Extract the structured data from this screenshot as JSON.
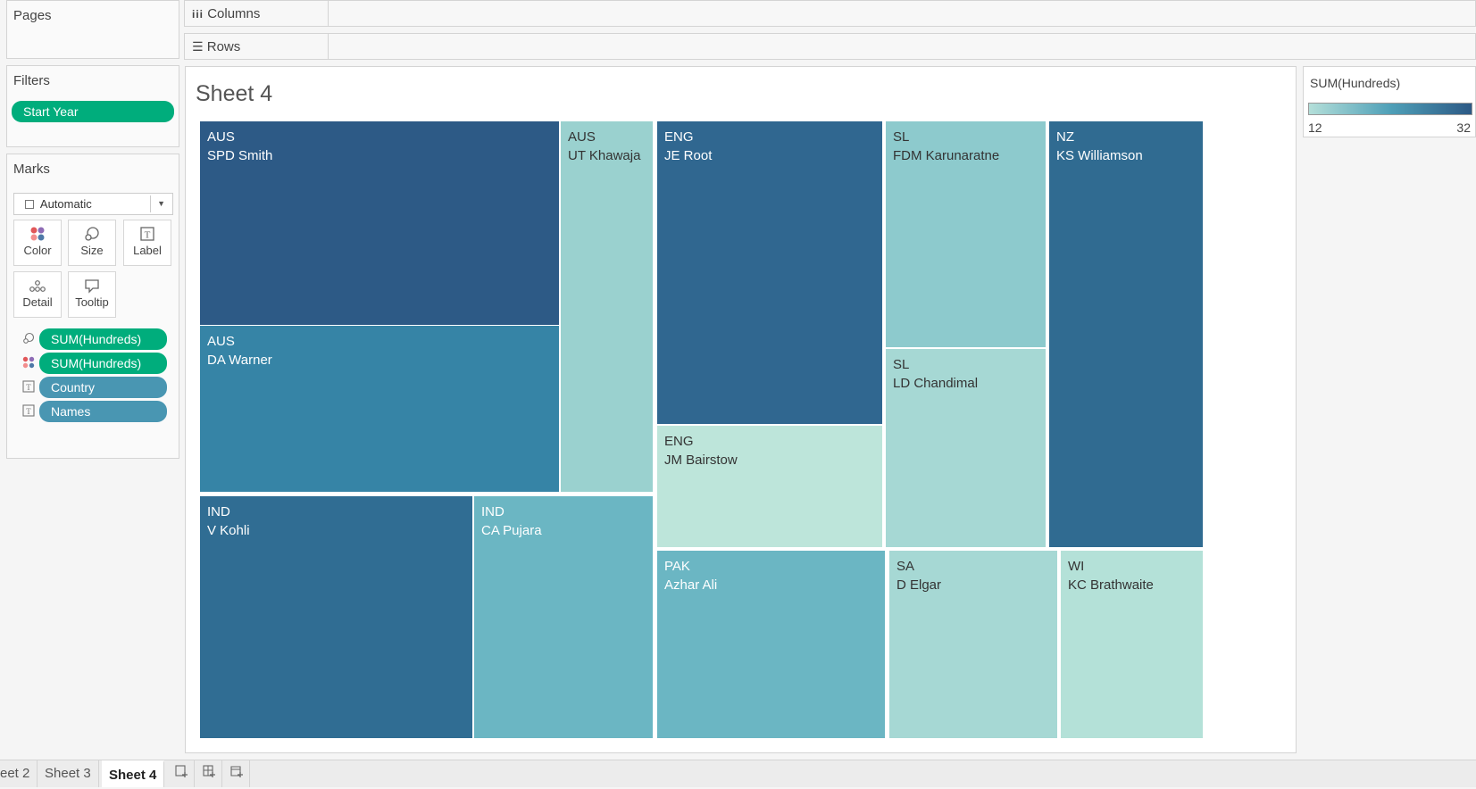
{
  "pages": {
    "title": "Pages"
  },
  "filters": {
    "title": "Filters",
    "pills": [
      "Start Year"
    ]
  },
  "marks": {
    "title": "Marks",
    "mark_type": "Automatic",
    "buttons": {
      "color": "Color",
      "size": "Size",
      "label": "Label",
      "detail": "Detail",
      "tooltip": "Tooltip"
    },
    "fields": [
      {
        "icon": "size-icon",
        "label": "SUM(Hundreds)",
        "kind": "measure"
      },
      {
        "icon": "color-icon",
        "label": "SUM(Hundreds)",
        "kind": "measure"
      },
      {
        "icon": "label-icon",
        "label": "Country",
        "kind": "dimension"
      },
      {
        "icon": "label-icon",
        "label": "Names",
        "kind": "dimension"
      }
    ]
  },
  "shelves": {
    "columns": "Columns",
    "rows": "Rows"
  },
  "sheet": {
    "title": "Sheet 4"
  },
  "legend": {
    "title": "SUM(Hundreds)",
    "min": "12",
    "max": "32",
    "color_min": "#b4dfd9",
    "color_max": "#2c5985"
  },
  "chart_data": {
    "type": "treemap",
    "tiles": [
      {
        "country": "AUS",
        "name": "SPD Smith",
        "color": "#2d5a86"
      },
      {
        "country": "AUS",
        "name": "DA Warner",
        "color": "#3684a6"
      },
      {
        "country": "AUS",
        "name": "UT Khawaja",
        "color": "#9ad1cf"
      },
      {
        "country": "IND",
        "name": "V Kohli",
        "color": "#306d93"
      },
      {
        "country": "IND",
        "name": "CA Pujara",
        "color": "#6bb6c3"
      },
      {
        "country": "ENG",
        "name": "JE Root",
        "color": "#306790"
      },
      {
        "country": "ENG",
        "name": "JM Bairstow",
        "color": "#bde5da"
      },
      {
        "country": "PAK",
        "name": "Azhar Ali",
        "color": "#6bb6c3"
      },
      {
        "country": "SL",
        "name": "FDM Karunaratne",
        "color": "#8dcacd"
      },
      {
        "country": "SL",
        "name": "LD Chandimal",
        "color": "#a6d8d4"
      },
      {
        "country": "SA",
        "name": "D Elgar",
        "color": "#a6d8d4"
      },
      {
        "country": "NZ",
        "name": "KS Williamson",
        "color": "#306b91"
      },
      {
        "country": "WI",
        "name": "KC Brathwaite",
        "color": "#b4e1d8"
      }
    ]
  },
  "tabs": [
    "eet 2",
    "Sheet 3",
    "Sheet 4"
  ]
}
